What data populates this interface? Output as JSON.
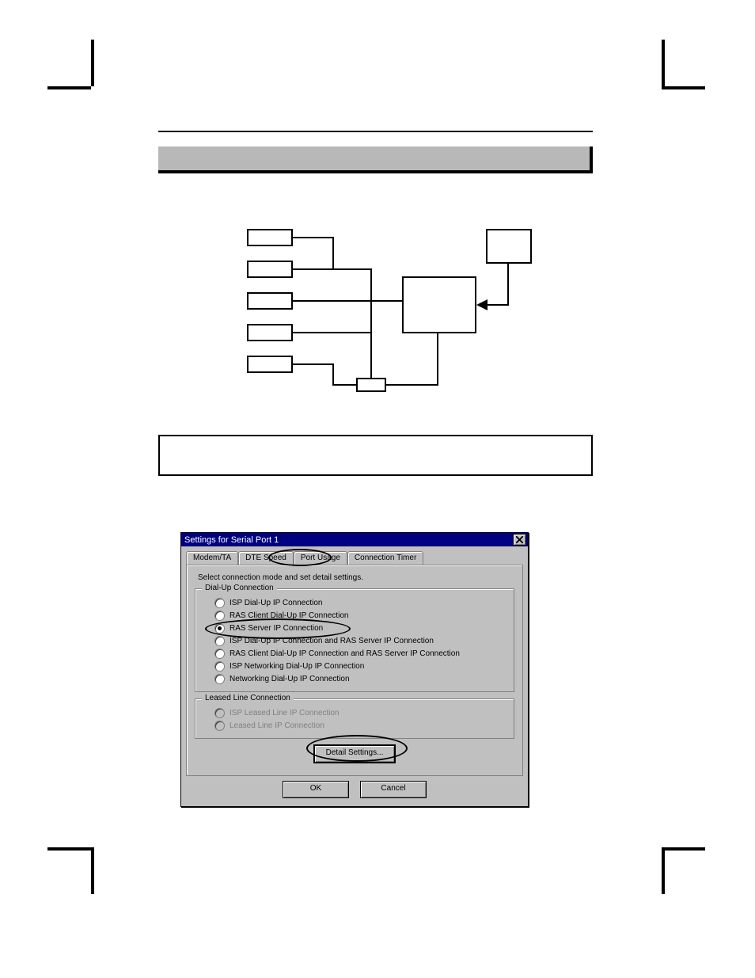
{
  "dialog": {
    "title": "Settings for Serial Port 1",
    "tabs": {
      "modem": "Modem/TA",
      "dte": "DTE Speed",
      "port_usage": "Port Usage",
      "conn_timer": "Connection Timer"
    },
    "instruction": "Select connection mode and set detail settings.",
    "group_dialup": "Dial-Up Connection",
    "group_leased": "Leased Line Connection",
    "radios": {
      "r1": "ISP Dial-Up IP Connection",
      "r2": "RAS Client Dial-Up IP Connection",
      "r3": "RAS Server IP Connection",
      "r4": "ISP Dial-Up IP Connection and RAS Server IP Connection",
      "r5": "RAS Client Dial-Up IP Connection and RAS Server IP Connection",
      "r6": "ISP Networking Dial-Up IP Connection",
      "r7": "Networking Dial-Up IP Connection",
      "r8": "ISP Leased Line IP Connection",
      "r9": "Leased Line IP Connection"
    },
    "buttons": {
      "detail": "Detail Settings...",
      "ok": "OK",
      "cancel": "Cancel"
    }
  }
}
